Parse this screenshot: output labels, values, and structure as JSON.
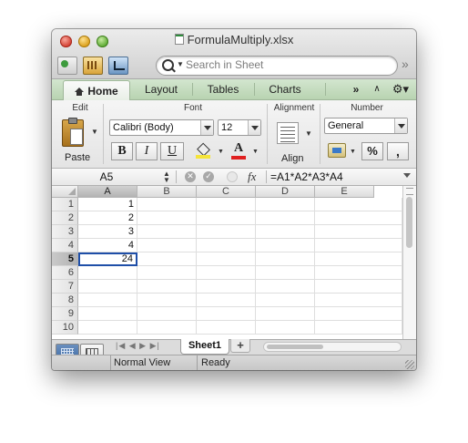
{
  "window": {
    "title": "FormulaMultiply.xlsx"
  },
  "toolbar": {
    "search_placeholder": "Search in Sheet"
  },
  "ribbon": {
    "tabs": [
      "Home",
      "Layout",
      "Tables",
      "Charts"
    ],
    "active_tab": "Home",
    "groups": {
      "edit": "Edit",
      "font": "Font",
      "alignment": "Alignment",
      "number": "Number"
    },
    "paste_label": "Paste",
    "font_name": "Calibri (Body)",
    "font_size": "12",
    "bold": "B",
    "italic": "I",
    "underline": "U",
    "font_color_glyph": "A",
    "align_label": "Align",
    "number_format": "General",
    "percent": "%",
    "comma": ",",
    "fill_color": "#f5e43a",
    "font_color": "#e02020"
  },
  "formula_bar": {
    "name_box": "A5",
    "fx": "fx",
    "formula": "=A1*A2*A3*A4"
  },
  "grid": {
    "columns": [
      "A",
      "B",
      "C",
      "D",
      "E"
    ],
    "rows": [
      "1",
      "2",
      "3",
      "4",
      "5",
      "6",
      "7",
      "8",
      "9",
      "10"
    ],
    "values": {
      "A1": "1",
      "A2": "2",
      "A3": "3",
      "A4": "4",
      "A5": "24"
    },
    "active_cell": "A5",
    "selection_color": "#1f4fa8"
  },
  "sheets": {
    "tabs": [
      "Sheet1"
    ],
    "add": "+"
  },
  "status": {
    "view": "Normal View",
    "state": "Ready"
  }
}
